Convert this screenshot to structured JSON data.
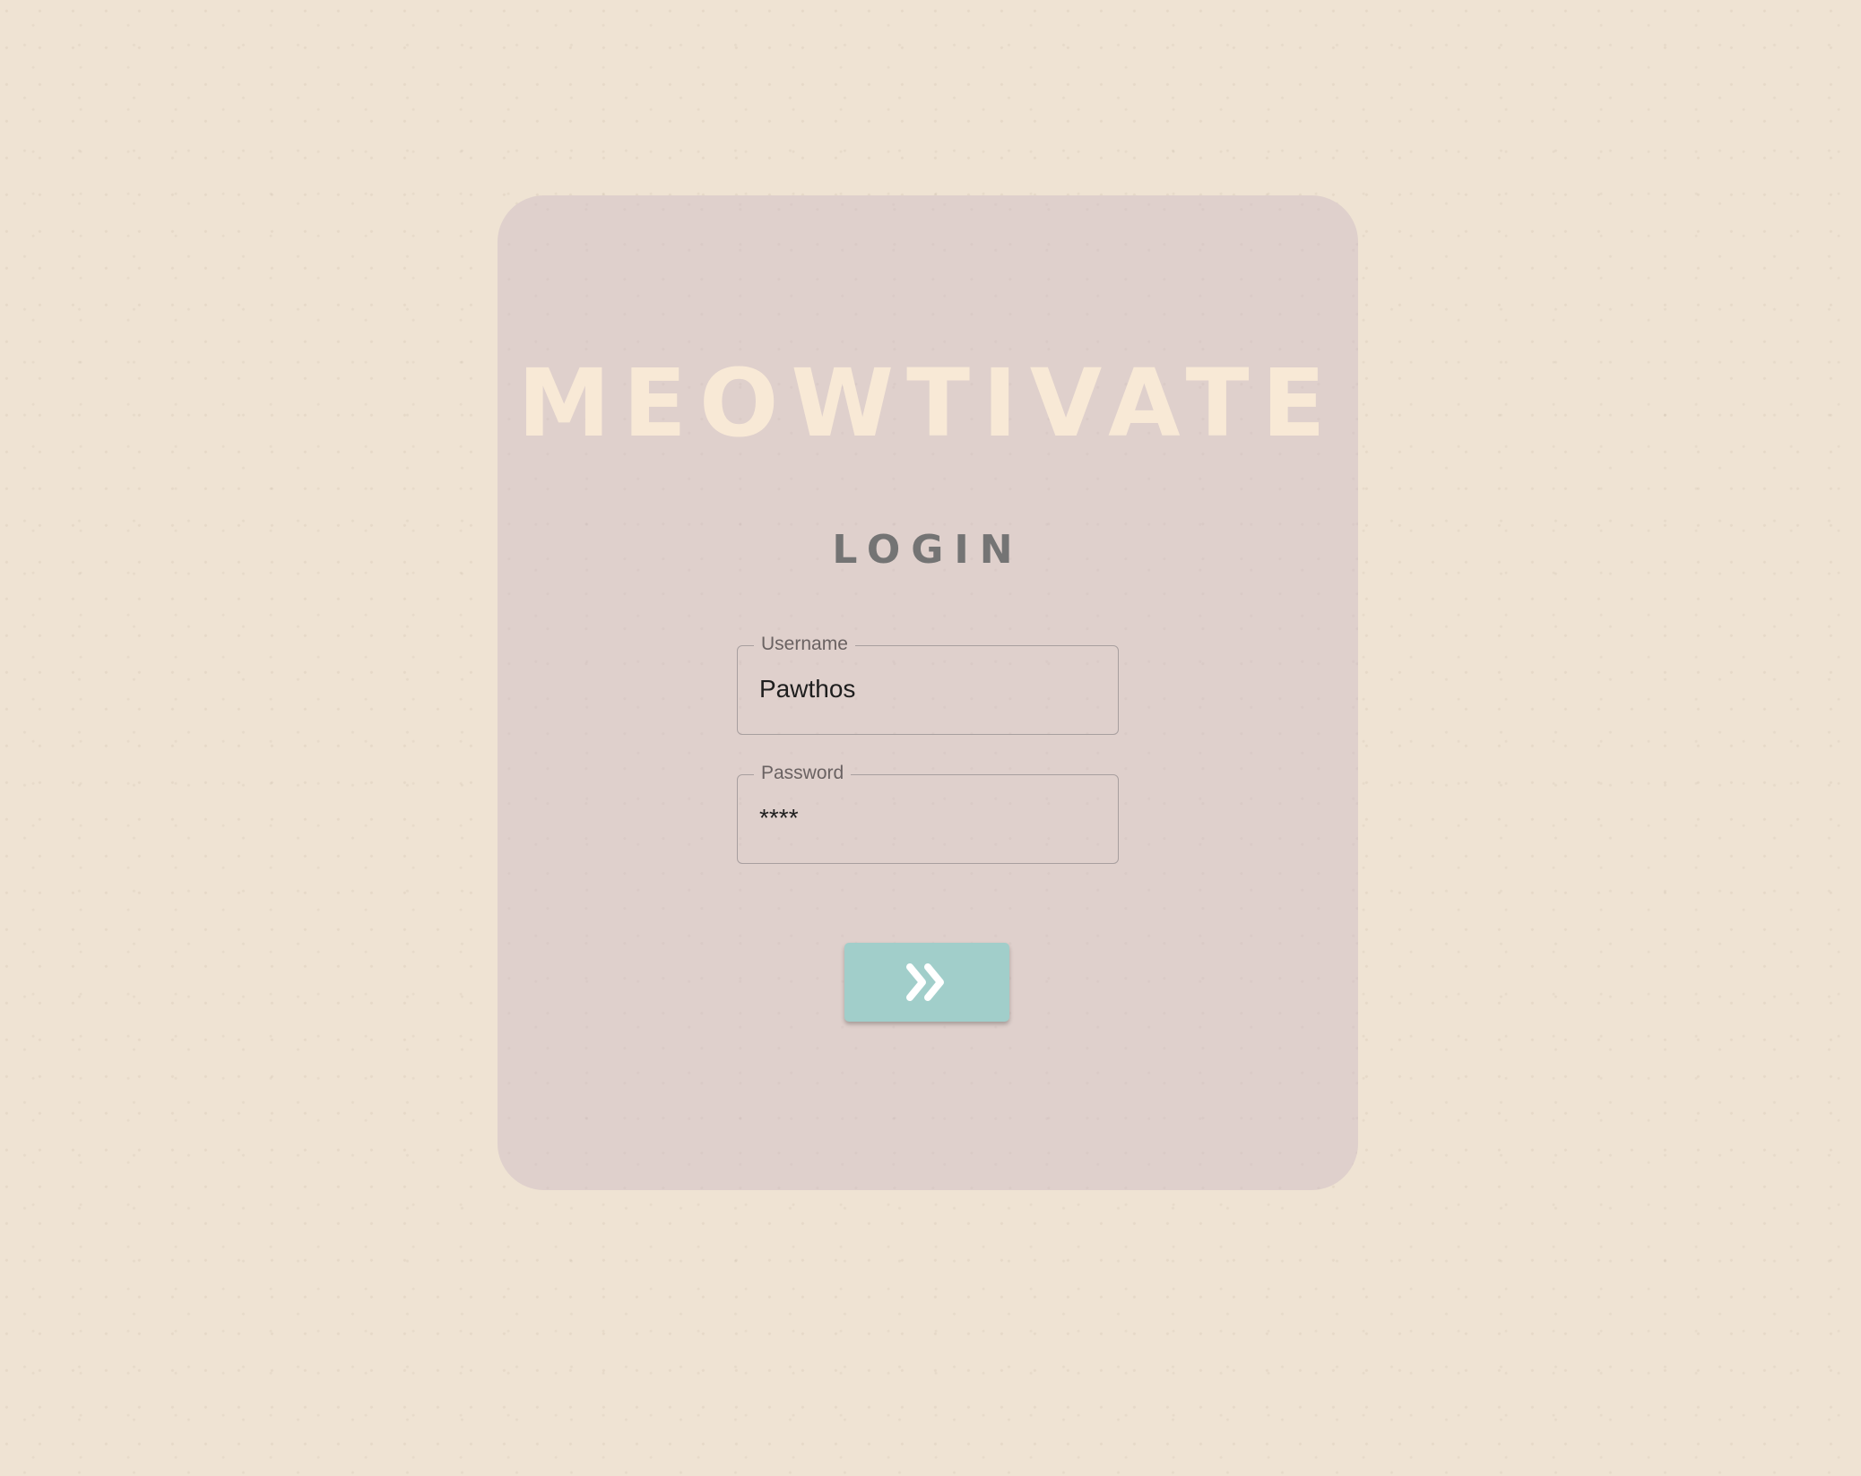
{
  "app": {
    "brand": "MEOWTIVATE"
  },
  "login": {
    "title": "LOGIN",
    "username": {
      "label": "Username",
      "value": "Pawthos"
    },
    "password": {
      "label": "Password",
      "value": "****"
    },
    "submit": {
      "icon": "double-chevron-right-icon"
    }
  },
  "colors": {
    "background": "#efe3d3",
    "card": "#dfd0cc",
    "brand_text": "#f8e9d6",
    "title_text": "#747474",
    "button": "#a1ceca"
  }
}
